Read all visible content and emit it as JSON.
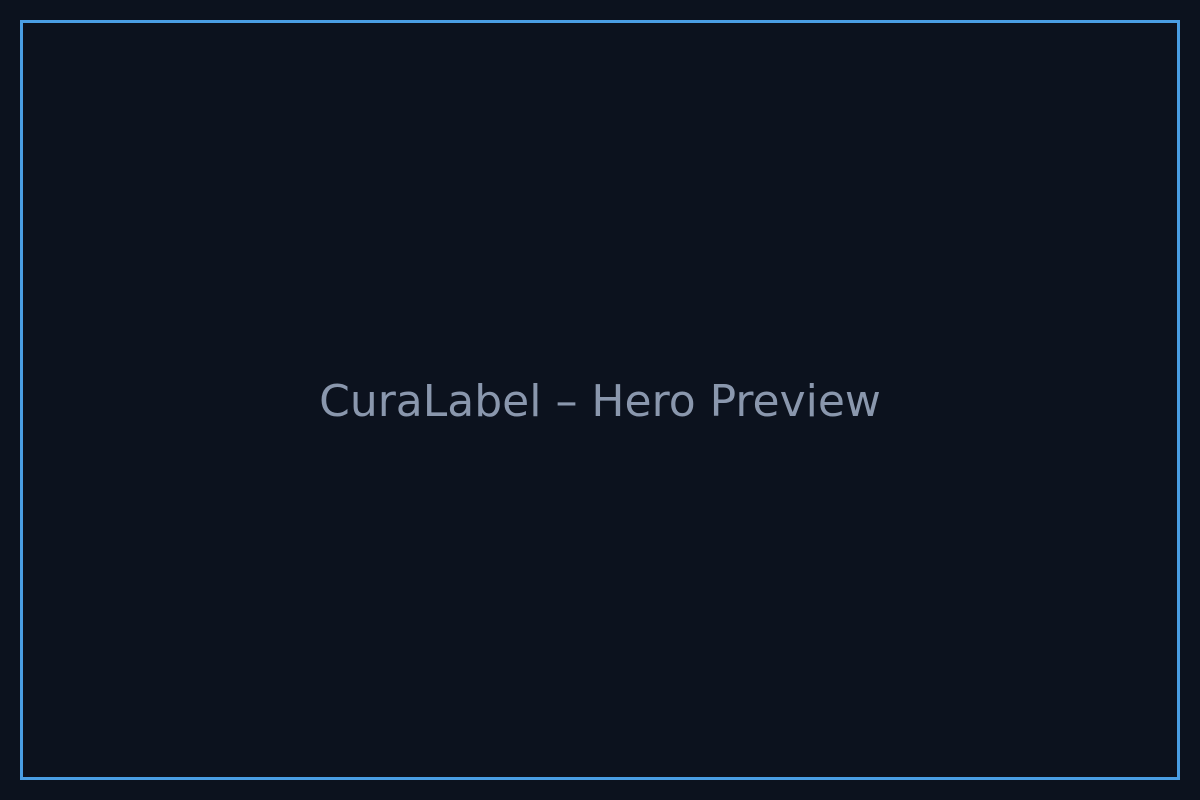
{
  "title": "CuraLabel – Hero Preview",
  "colors": {
    "background": "#0c121e",
    "frame_border": "#4a9ee4",
    "title_text": "#8a97ad"
  }
}
